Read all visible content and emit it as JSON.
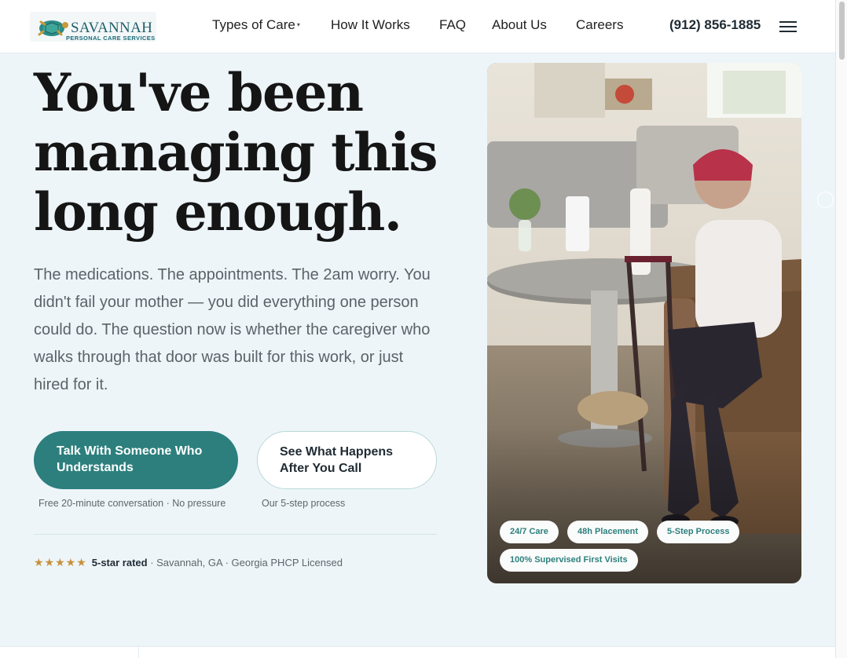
{
  "header": {
    "logo": {
      "name": "SAVANNAH",
      "subtitle": "PERSONAL CARE SERVICES"
    },
    "nav": [
      {
        "label": "Types of Care",
        "has_dropdown": true
      },
      {
        "label": "How It Works"
      },
      {
        "label": "FAQ"
      },
      {
        "label": "About Us"
      },
      {
        "label": "Careers"
      }
    ],
    "nav_caret": "▾",
    "phone": "(912) 856-1885",
    "menu_icon": "hamburger-icon"
  },
  "hero": {
    "headline": [
      "You've been",
      "managing this",
      "long enough."
    ],
    "subtext": "The medications. The appointments. The 2am worry. You didn't fail your mother — you did everything one person could do. The question now is whether the caregiver who walks through that door was built for this work, or just hired for it.",
    "primary_cta": {
      "label": "Talk With Someone Who Understands",
      "note": "Free 20-minute conversation · No pressure"
    },
    "secondary_cta": {
      "label": "See What Happens After You Call",
      "note": "Our 5-step process"
    },
    "rating": {
      "stars": "★★★★★",
      "label": "5-star rated",
      "details": " · Savannah, GA · Georgia PHCP Licensed"
    }
  },
  "photo": {
    "chips": [
      "24/7 Care",
      "48h Placement",
      "5-Step Process",
      "100% Supervised First Visits"
    ]
  },
  "colors": {
    "accent": "#2c7f7d",
    "background": "#eef5f9",
    "star": "#c7913b",
    "text_muted": "#5a6369"
  }
}
